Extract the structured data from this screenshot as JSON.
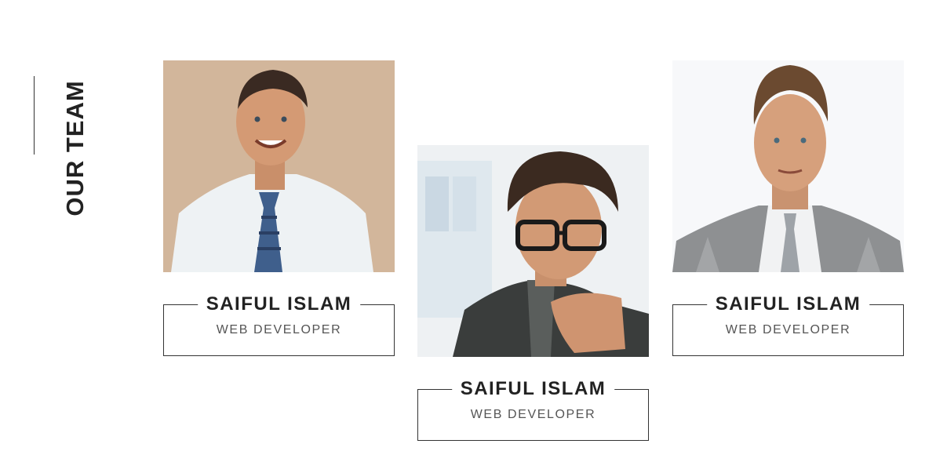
{
  "section": {
    "title": "OUR TEAM"
  },
  "members": [
    {
      "name": "SAIFUL ISLAM",
      "role": "WEB DEVELOPER",
      "photo_icon": "person-photo-smiling-tie"
    },
    {
      "name": "SAIFUL ISLAM",
      "role": "WEB DEVELOPER",
      "photo_icon": "person-photo-glasses"
    },
    {
      "name": "SAIFUL ISLAM",
      "role": "WEB DEVELOPER",
      "photo_icon": "person-photo-grey-suit"
    }
  ],
  "colors": {
    "text": "#222222",
    "subtext": "#555555",
    "border": "#333333",
    "background": "#ffffff"
  }
}
